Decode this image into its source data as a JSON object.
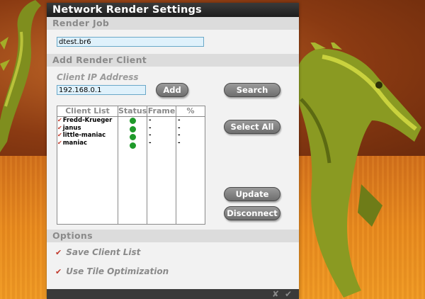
{
  "dialog": {
    "title": "Network Render Settings",
    "render_job": {
      "section_label": "Render Job",
      "filename": "dtest.br6"
    },
    "add_client": {
      "section_label": "Add Render Client",
      "ip_label": "Client IP Address",
      "ip_value": "192.168.0.1",
      "add_button": "Add",
      "search_button": "Search",
      "select_all_button": "Select All",
      "update_button": "Update",
      "disconnect_button": "Disconnect"
    },
    "client_table": {
      "headers": [
        "Client List",
        "Status",
        "Frame",
        "%"
      ],
      "rows": [
        {
          "name": "Fredd-Krueger",
          "status": "online",
          "frame": "-",
          "percent": "-"
        },
        {
          "name": "janus",
          "status": "online",
          "frame": "-",
          "percent": "-"
        },
        {
          "name": "little-maniac",
          "status": "online",
          "frame": "-",
          "percent": "-"
        },
        {
          "name": "maniac",
          "status": "online",
          "frame": "-",
          "percent": "-"
        }
      ]
    },
    "options": {
      "section_label": "Options",
      "save_client_list": "Save Client List",
      "use_tile_optimization": "Use Tile Optimization"
    },
    "footer": {
      "cancel_icon": "close-icon",
      "ok_icon": "checkmark-icon"
    }
  },
  "colors": {
    "status_online": "#1f9a2a",
    "check": "#c0392b",
    "input_bg": "#dff1fb"
  }
}
